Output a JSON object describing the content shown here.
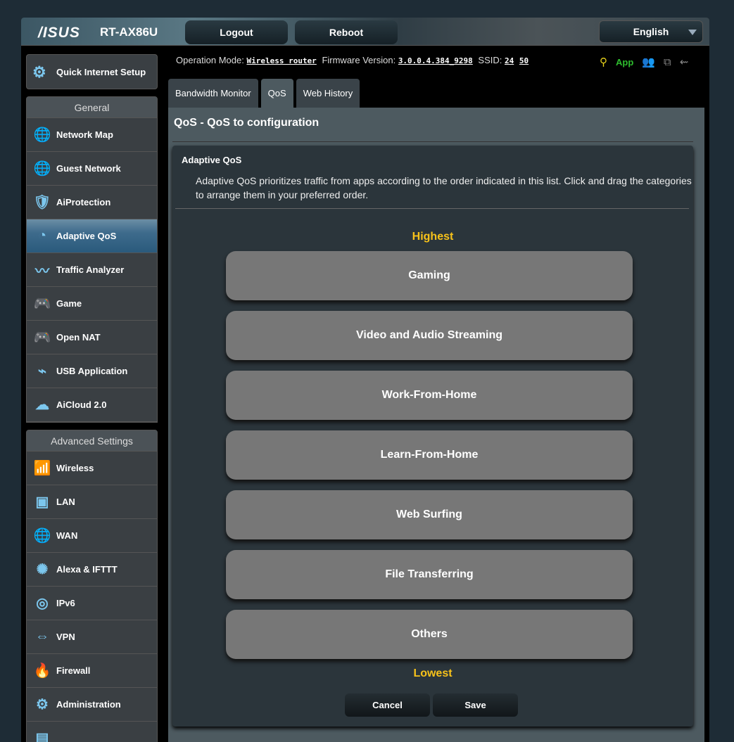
{
  "header": {
    "brand": "/ISUS",
    "model": "RT-AX86U",
    "logout": "Logout",
    "reboot": "Reboot",
    "language": "English"
  },
  "info": {
    "op_label": "Operation Mode:",
    "op_value": "Wireless router",
    "fw_label": "Firmware Version:",
    "fw_value": "3.0.0.4.384_9298",
    "ssid_label": "SSID:",
    "ssid1": "24",
    "ssid2": "50",
    "app": "App"
  },
  "sidebar": {
    "qis": "Quick Internet Setup",
    "general": "General",
    "general_items": [
      {
        "label": "Network Map",
        "icon": "🌐"
      },
      {
        "label": "Guest Network",
        "icon": "🌐"
      },
      {
        "label": "AiProtection",
        "icon": "🛡"
      },
      {
        "label": "Adaptive QoS",
        "icon": "◔"
      },
      {
        "label": "Traffic Analyzer",
        "icon": "〰"
      },
      {
        "label": "Game",
        "icon": "🎮"
      },
      {
        "label": "Open NAT",
        "icon": "🎮"
      },
      {
        "label": "USB Application",
        "icon": "⌁"
      },
      {
        "label": "AiCloud 2.0",
        "icon": "☁"
      }
    ],
    "advanced": "Advanced Settings",
    "advanced_items": [
      {
        "label": "Wireless",
        "icon": "📶"
      },
      {
        "label": "LAN",
        "icon": "▣"
      },
      {
        "label": "WAN",
        "icon": "🌐"
      },
      {
        "label": "Alexa & IFTTT",
        "icon": "✺"
      },
      {
        "label": "IPv6",
        "icon": "◎"
      },
      {
        "label": "VPN",
        "icon": "⇔"
      },
      {
        "label": "Firewall",
        "icon": "🔥"
      },
      {
        "label": "Administration",
        "icon": "⚙"
      },
      {
        "label": "",
        "icon": "▤"
      }
    ]
  },
  "tabs": [
    "Bandwidth Monitor",
    "QoS",
    "Web History"
  ],
  "main": {
    "title": "QoS - QoS to configuration",
    "card_title": "Adaptive QoS",
    "description": "Adaptive QoS prioritizes traffic from apps according to the order indicated in this list. Click and drag the categories to arrange them in your preferred order.",
    "highest": "Highest",
    "lowest": "Lowest",
    "categories": [
      "Gaming",
      "Video and Audio Streaming",
      "Work-From-Home",
      "Learn-From-Home",
      "Web Surfing",
      "File Transferring",
      "Others"
    ],
    "cancel": "Cancel",
    "save": "Save"
  },
  "colors": {
    "accent": "#f7c21a",
    "app": "#2ebd2e"
  }
}
